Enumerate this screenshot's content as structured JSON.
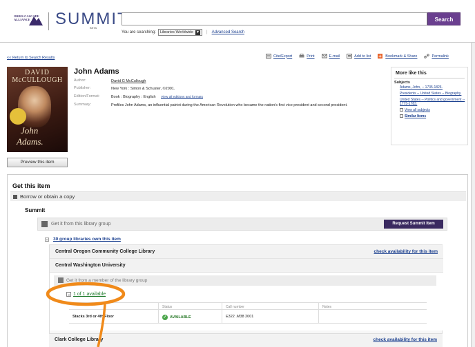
{
  "header": {
    "cascade_logo_text": "ORBIS CASCADE ALLIANCE",
    "app_name": "SUMMIT",
    "beta_label": "BETA",
    "search_value": "",
    "search_button": "Search",
    "searching_label": "You are searching:",
    "scope_selected": "Libraries Worldwide",
    "advanced_search": "Advanced Search"
  },
  "toolbar": {
    "return_link": "<< Return to Search Results",
    "cite": "Cite/Export",
    "print": "Print",
    "email": "E-mail",
    "add_to_list": "Add to list",
    "bookmark": "Bookmark & Share",
    "permalink": "Permalink"
  },
  "record": {
    "cover_author_line1": "DAVID",
    "cover_author_line2": "McCULLOUGH",
    "cover_title_line1": "John",
    "cover_title_line2": "Adams.",
    "title": "John Adams",
    "author_label": "Author:",
    "author_value": "David G McCullough",
    "publisher_label": "Publisher:",
    "publisher_value": "New York : Simon & Schuster, ©2001.",
    "edition_label": "Edition/Format:",
    "edition_value": "Book : Biography : English",
    "edition_link": "View all editions and formats",
    "summary_label": "Summary:",
    "summary_value": "Profiles John Adams, an influential patriot during the American Revolution who became the nation's first vice president and second president.",
    "preview_button": "Preview this item"
  },
  "sidebar": {
    "heading": "More like this",
    "subjects_label": "Subjects",
    "subjects": [
      "Adams, John, -- 1735-1826.",
      "Presidents -- United States -- Biography.",
      "United States -- Politics and government -- 1775-1783."
    ],
    "view_all": "View all subjects",
    "similar": "Similar Items"
  },
  "get_item": {
    "title": "Get this item",
    "borrow_label": "Borrow or obtain a copy",
    "summit_heading": "Summit",
    "group_label": "Get it from this library group",
    "request_button": "Request Summit Item",
    "own_count": "30 group libraries own this item",
    "libraries": [
      {
        "name": "Central Oregon Community College Library",
        "check": "check availability for this item"
      },
      {
        "name": "Central Washington University",
        "check": ""
      },
      {
        "name": "Clark College Library",
        "check": "check availability for this item"
      }
    ],
    "member_label": "Get it from a member of the library group",
    "available_link": "1 of 1 available",
    "table_headers": [
      "",
      "Status",
      "Call number",
      "Notes"
    ],
    "table_rows": [
      {
        "location": "Stacks 3rd or 4th Floor",
        "status": "AVAILABLE",
        "call_number": "E322 .M38 2001",
        "notes": ""
      }
    ]
  },
  "colors": {
    "brand_purple": "#6a3f8f",
    "request_button": "#3a2a60",
    "link_blue": "#1a3f8f",
    "available_green": "#2a7a2a",
    "annotation_orange": "#f08a1a"
  }
}
